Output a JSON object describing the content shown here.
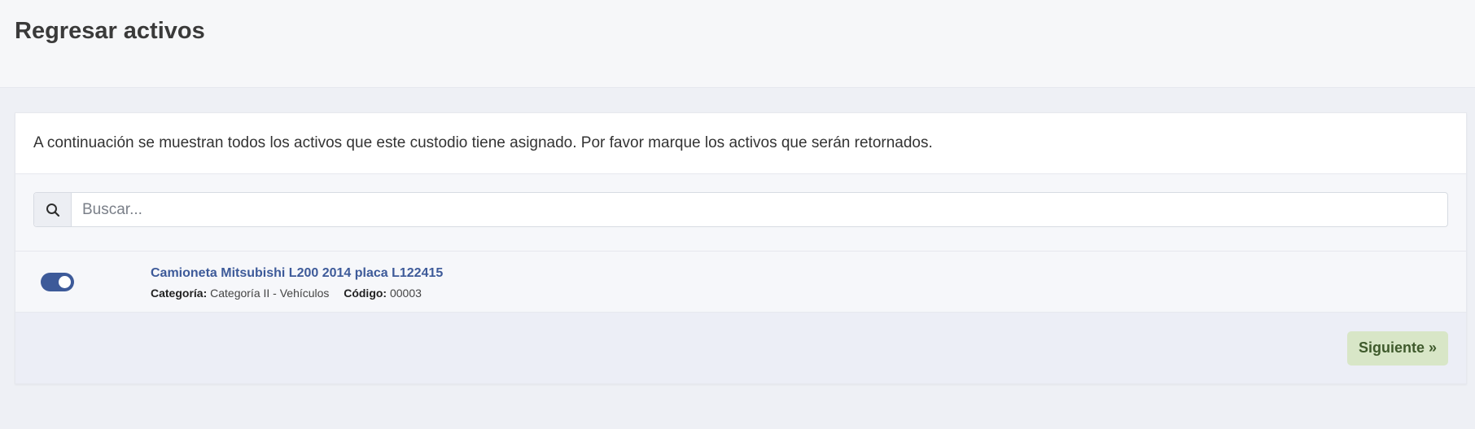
{
  "page": {
    "title": "Regresar activos"
  },
  "card": {
    "intro": "A continuación se muestran todos los activos que este custodio tiene asignado. Por favor marque los activos que serán retornados."
  },
  "search": {
    "icon": "search-icon",
    "placeholder": "Buscar...",
    "value": ""
  },
  "assets": [
    {
      "selected": true,
      "title": "Camioneta Mitsubishi L200 2014 placa L122415",
      "category_label": "Categoría:",
      "category_value": "Categoría II - Vehículos",
      "code_label": "Código:",
      "code_value": "00003"
    }
  ],
  "footer": {
    "next_label": "Siguiente »"
  },
  "colors": {
    "accent": "#3d5a99",
    "next_bg": "#d8e6c7",
    "next_text": "#3f5a2c"
  }
}
